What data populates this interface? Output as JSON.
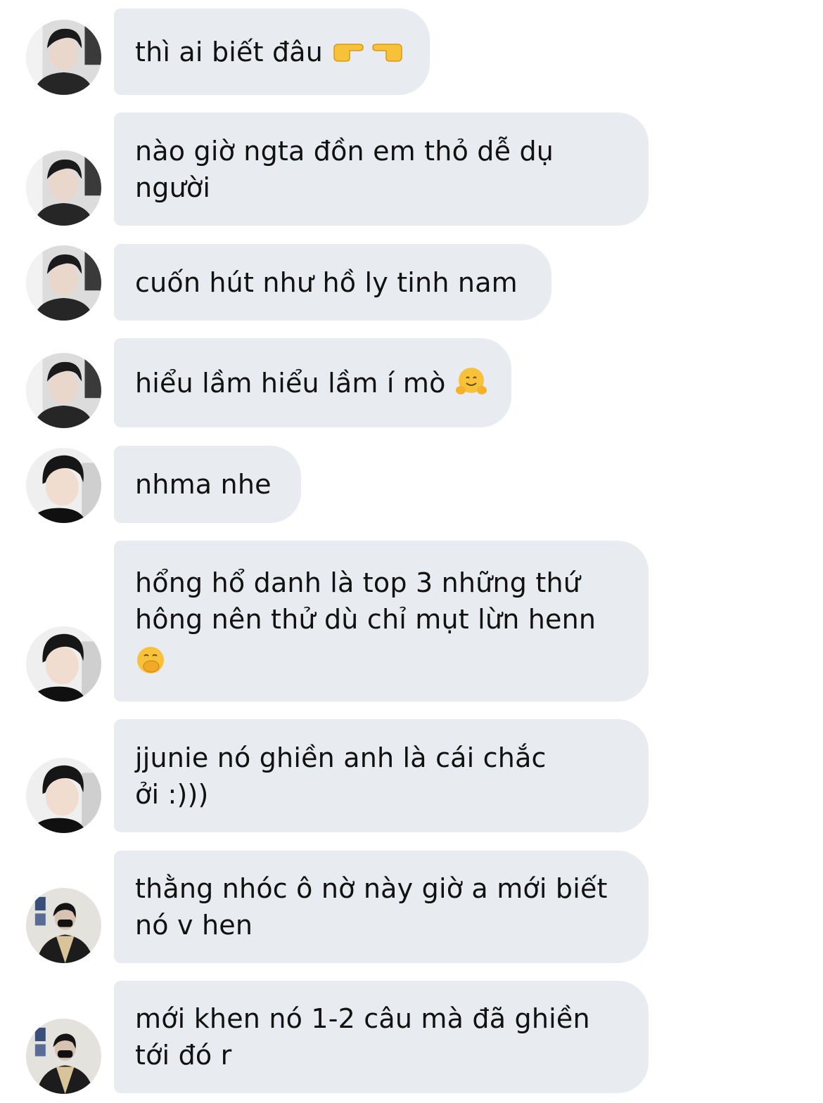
{
  "colors": {
    "bubble": "#e8ebf0",
    "text": "#111111",
    "background": "#ffffff"
  },
  "messages": [
    {
      "text": "thì ai biết đâu",
      "emojis": [
        "pointing-right-emoji",
        "pointing-left-emoji"
      ],
      "avatar": "user-a"
    },
    {
      "text": "nào giờ ngta đồn em thỏ dễ dụ\nngười",
      "avatar": "user-a"
    },
    {
      "text": "cuốn hút như hồ ly tinh nam",
      "avatar": "user-a"
    },
    {
      "text": "hiểu lầm hiểu lầm í mò",
      "emojis": [
        "hugging-face-emoji"
      ],
      "avatar": "user-a"
    },
    {
      "text": "nhma nhe",
      "avatar": "user-b"
    },
    {
      "text": "hổng hổ danh là top 3 những thứ\nhông nên thử dù chỉ mụt lừn henn",
      "emojis": [
        "face-with-hand-over-mouth-emoji"
      ],
      "avatar": "user-b"
    },
    {
      "text": "jjunie nó ghiền anh là cái chắc\nởi :)))",
      "avatar": "user-b"
    },
    {
      "text": "thằng nhóc ô nờ này giờ a mới biết\nnó v hen",
      "avatar": "user-c"
    },
    {
      "text": "mới khen nó 1-2 câu mà đã ghiền\ntới đó r",
      "avatar": "user-c"
    }
  ]
}
